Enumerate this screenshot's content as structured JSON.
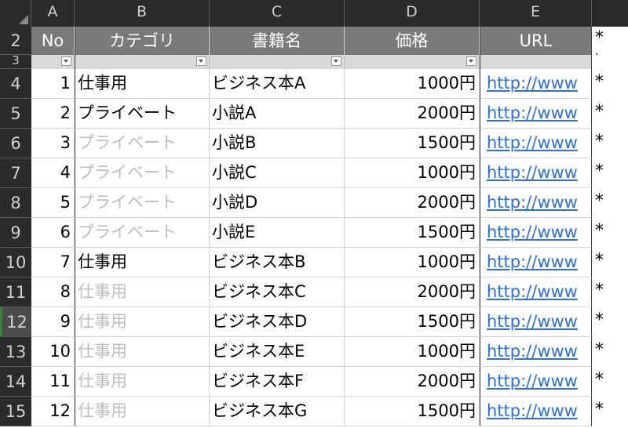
{
  "columns": [
    "A",
    "B",
    "C",
    "D",
    "E"
  ],
  "header": {
    "row_no": "2",
    "cells": [
      "No",
      "カテゴリ",
      "書籍名",
      "価格",
      "URL"
    ],
    "star": "*"
  },
  "filter_row": {
    "row_no": "3",
    "star": "·"
  },
  "rows": [
    {
      "row_no": "4",
      "no": "1",
      "category": "仕事用",
      "title": "ビジネス本A",
      "price": "1000円",
      "url": "http://www",
      "dim": false
    },
    {
      "row_no": "5",
      "no": "2",
      "category": "プライベート",
      "title": "小説A",
      "price": "2000円",
      "url": "http://www",
      "dim": false
    },
    {
      "row_no": "6",
      "no": "3",
      "category": "プライベート",
      "title": "小説B",
      "price": "1500円",
      "url": "http://www",
      "dim": true
    },
    {
      "row_no": "7",
      "no": "4",
      "category": "プライベート",
      "title": "小説C",
      "price": "1000円",
      "url": "http://www",
      "dim": true
    },
    {
      "row_no": "8",
      "no": "5",
      "category": "プライベート",
      "title": "小説D",
      "price": "2000円",
      "url": "http://www",
      "dim": true
    },
    {
      "row_no": "9",
      "no": "6",
      "category": "プライベート",
      "title": "小説E",
      "price": "1500円",
      "url": "http://www",
      "dim": true
    },
    {
      "row_no": "10",
      "no": "7",
      "category": "仕事用",
      "title": "ビジネス本B",
      "price": "1000円",
      "url": "http://www",
      "dim": false
    },
    {
      "row_no": "11",
      "no": "8",
      "category": "仕事用",
      "title": "ビジネス本C",
      "price": "2000円",
      "url": "http://www",
      "dim": true
    },
    {
      "row_no": "12",
      "no": "9",
      "category": "仕事用",
      "title": "ビジネス本D",
      "price": "1500円",
      "url": "http://www",
      "dim": true,
      "active": true
    },
    {
      "row_no": "13",
      "no": "10",
      "category": "仕事用",
      "title": "ビジネス本E",
      "price": "1000円",
      "url": "http://www",
      "dim": true
    },
    {
      "row_no": "14",
      "no": "11",
      "category": "仕事用",
      "title": "ビジネス本F",
      "price": "2000円",
      "url": "http://www",
      "dim": true
    },
    {
      "row_no": "15",
      "no": "12",
      "category": "仕事用",
      "title": "ビジネス本G",
      "price": "1500円",
      "url": "http://www",
      "dim": true
    }
  ],
  "row_star": "*"
}
